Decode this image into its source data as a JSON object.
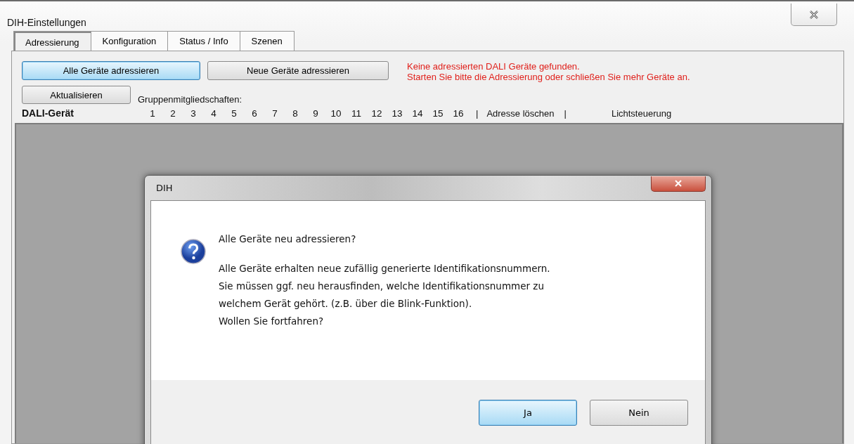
{
  "window": {
    "title": "DIH-Einstellungen"
  },
  "tabs": [
    {
      "label": "Adressierung",
      "selected": true
    },
    {
      "label": "Konfiguration",
      "selected": false
    },
    {
      "label": "Status / Info",
      "selected": false
    },
    {
      "label": "Szenen",
      "selected": false
    }
  ],
  "buttons": [
    {
      "label": "Alle Geräte adressieren",
      "focused": true
    },
    {
      "label": "Neue Geräte adressieren",
      "focused": false
    }
  ],
  "refresh_button": {
    "label": "Aktualisieren"
  },
  "error_lines": [
    "Keine adressierten DALI Geräte gefunden.",
    "Starten Sie bitte die Adressierung oder schließen Sie mehr Geräte an."
  ],
  "groups_label": "Gruppenmitgliedschaften:",
  "header": {
    "device": "DALI-Gerät",
    "groups": [
      "1",
      "2",
      "3",
      "4",
      "5",
      "6",
      "7",
      "8",
      "9",
      "10",
      "11",
      "12",
      "13",
      "14",
      "15",
      "16"
    ],
    "separator_1": "|",
    "delete": "Adresse löschen",
    "separator_2": "|",
    "light": "Lichtsteuerung"
  },
  "dialog": {
    "title": "DIH",
    "question": "Alle Geräte neu adressieren?",
    "lines": [
      "Alle Geräte erhalten neue zufällig generierte Identifikationsnummern.",
      "Sie müssen ggf. neu herausfinden, welche Identifikationsnummer zu",
      "welchem Gerät gehört. (z.B. über die Blink-Funktion).",
      "Wollen Sie fortfahren?"
    ],
    "buttons": [
      {
        "label": "Ja",
        "focused": true
      },
      {
        "label": "Nein",
        "focused": false
      }
    ]
  }
}
